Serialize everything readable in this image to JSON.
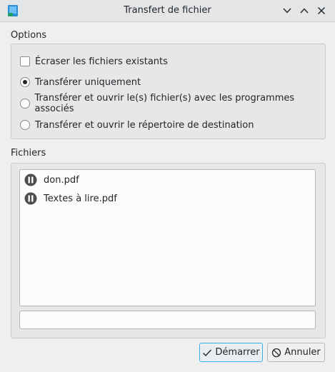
{
  "window": {
    "title": "Transfert de fichier"
  },
  "options": {
    "section_label": "Options",
    "overwrite_label": "Écraser les fichiers existants",
    "overwrite_checked": false,
    "mode_selected": 0,
    "modes": [
      "Transférer uniquement",
      "Transférer et ouvrir le(s) fichier(s) avec les programmes associés",
      "Transférer et ouvrir le répertoire de destination"
    ]
  },
  "files": {
    "section_label": "Fichiers",
    "items": [
      {
        "name": "don.pdf",
        "status_icon": "pause-icon"
      },
      {
        "name": "Textes à lire.pdf",
        "status_icon": "pause-icon"
      }
    ],
    "field_value": ""
  },
  "buttons": {
    "start_label": "Démarrer",
    "cancel_label": "Annuler"
  },
  "colors": {
    "accent": "#3daee9",
    "icon_dark": "#4d4d4d"
  }
}
